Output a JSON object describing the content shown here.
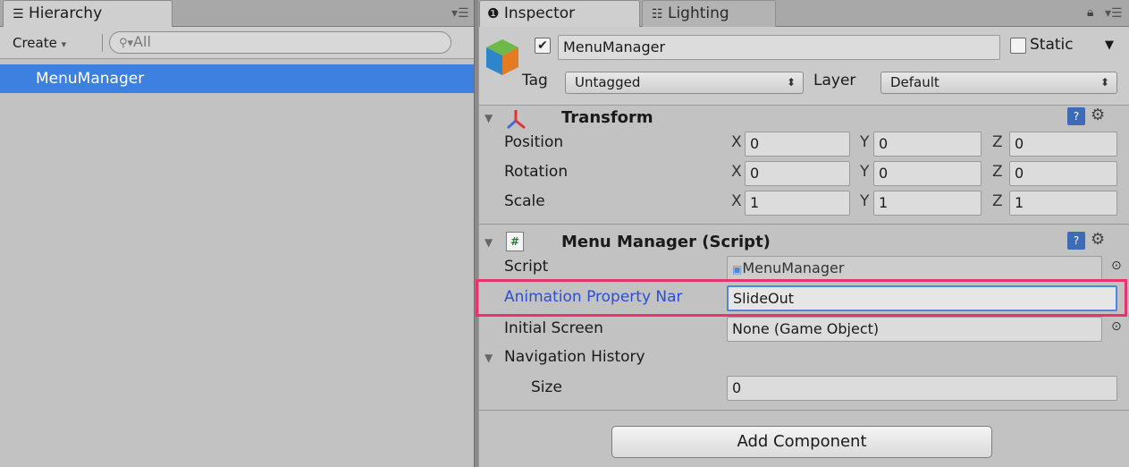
{
  "hierarchy": {
    "tab_label": "Hierarchy",
    "create_label": "Create",
    "search_placeholder": "All",
    "items": [
      {
        "label": "MenuManager"
      }
    ]
  },
  "inspector": {
    "tabs": [
      {
        "label": "Inspector"
      },
      {
        "label": "Lighting"
      }
    ],
    "object": {
      "name": "MenuManager",
      "active": true,
      "static_label": "Static",
      "static": false,
      "tag_label": "Tag",
      "tag_value": "Untagged",
      "layer_label": "Layer",
      "layer_value": "Default"
    },
    "transform": {
      "title": "Transform",
      "rows": [
        {
          "label": "Position",
          "x": "0",
          "y": "0",
          "z": "0"
        },
        {
          "label": "Rotation",
          "x": "0",
          "y": "0",
          "z": "0"
        },
        {
          "label": "Scale",
          "x": "1",
          "y": "1",
          "z": "1"
        }
      ],
      "axis": {
        "x": "X",
        "y": "Y",
        "z": "Z"
      }
    },
    "script_component": {
      "title": "Menu Manager (Script)",
      "script_label": "Script",
      "script_value": "MenuManager",
      "anim_label": "Animation Property Nar",
      "anim_value": "SlideOut",
      "initial_label": "Initial Screen",
      "initial_value": "None (Game Object)",
      "nav_label": "Navigation History",
      "size_label": "Size",
      "size_value": "0"
    },
    "add_component_label": "Add Component"
  },
  "colors": {
    "selection": "#3d80df",
    "highlight_box": "#e8336f",
    "focused_label": "#2a4fd0"
  }
}
